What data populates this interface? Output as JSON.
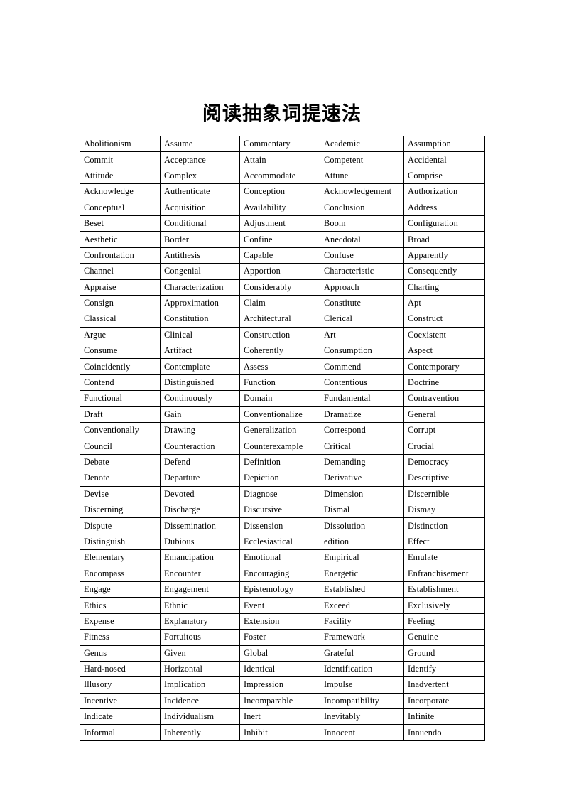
{
  "document": {
    "title": "阅读抽象词提速法"
  },
  "table": {
    "column_count": 5,
    "row_count": 38,
    "rows": [
      [
        "Abolitionism",
        "Assume",
        "Commentary",
        "Academic",
        "Assumption"
      ],
      [
        "Commit",
        "Acceptance",
        "Attain",
        "Competent",
        "Accidental"
      ],
      [
        "Attitude",
        "Complex",
        "Accommodate",
        "Attune",
        "Comprise"
      ],
      [
        "Acknowledge",
        "Authenticate",
        "Conception",
        "Acknowledgement",
        "Authorization"
      ],
      [
        "Conceptual",
        "Acquisition",
        "Availability",
        "Conclusion",
        "Address"
      ],
      [
        "Beset",
        "Conditional",
        "Adjustment",
        "Boom",
        "Configuration"
      ],
      [
        "Aesthetic",
        "Border",
        "Confine",
        "Anecdotal",
        "Broad"
      ],
      [
        "Confrontation",
        "Antithesis",
        "Capable",
        "Confuse",
        "Apparently"
      ],
      [
        "Channel",
        "Congenial",
        "Apportion",
        "Characteristic",
        "Consequently"
      ],
      [
        "Appraise",
        "Characterization",
        "Considerably",
        "Approach",
        "Charting"
      ],
      [
        "Consign",
        "Approximation",
        "Claim",
        "Constitute",
        "Apt"
      ],
      [
        "Classical",
        "Constitution",
        "Architectural",
        "Clerical",
        "Construct"
      ],
      [
        "Argue",
        "Clinical",
        "Construction",
        "Art",
        "Coexistent"
      ],
      [
        "Consume",
        "Artifact",
        "Coherently",
        "Consumption",
        "Aspect"
      ],
      [
        "Coincidently",
        "Contemplate",
        "Assess",
        "Commend",
        "Contemporary"
      ],
      [
        "Contend",
        "Distinguished",
        "Function",
        "Contentious",
        "Doctrine"
      ],
      [
        "Functional",
        "Continuously",
        "Domain",
        "Fundamental",
        "Contravention"
      ],
      [
        "Draft",
        "Gain",
        "Conventionalize",
        "Dramatize",
        "General"
      ],
      [
        "Conventionally",
        "Drawing",
        "Generalization",
        "Correspond",
        "Corrupt"
      ],
      [
        "Council",
        "Counteraction",
        "Counterexample",
        "Critical",
        "Crucial"
      ],
      [
        "Debate",
        "Defend",
        "Definition",
        "Demanding",
        "Democracy"
      ],
      [
        "Denote",
        "Departure",
        "Depiction",
        "Derivative",
        "Descriptive"
      ],
      [
        "Devise",
        "Devoted",
        "Diagnose",
        "Dimension",
        "Discernible"
      ],
      [
        "Discerning",
        "Discharge",
        "Discursive",
        "Dismal",
        "Dismay"
      ],
      [
        "Dispute",
        "Dissemination",
        "Dissension",
        "Dissolution",
        "Distinction"
      ],
      [
        "Distinguish",
        "Dubious",
        "Ecclesiastical",
        "edition",
        "Effect"
      ],
      [
        "Elementary",
        "Emancipation",
        "Emotional",
        "Empirical",
        "Emulate"
      ],
      [
        "Encompass",
        "Encounter",
        "Encouraging",
        "Energetic",
        "Enfranchisement"
      ],
      [
        "Engage",
        "Engagement",
        "Epistemology",
        "Established",
        "Establishment"
      ],
      [
        "Ethics",
        "Ethnic",
        "Event",
        "Exceed",
        "Exclusively"
      ],
      [
        "Expense",
        "Explanatory",
        "Extension",
        "Facility",
        "Feeling"
      ],
      [
        "Fitness",
        "Fortuitous",
        "Foster",
        "Framework",
        "Genuine"
      ],
      [
        "Genus",
        "Given",
        "Global",
        "Grateful",
        "Ground"
      ],
      [
        "Hard-nosed",
        "Horizontal",
        "Identical",
        "Identification",
        "Identify"
      ],
      [
        "Illusory",
        "Implication",
        "Impression",
        "Impulse",
        "Inadvertent"
      ],
      [
        "Incentive",
        "Incidence",
        "Incomparable",
        "Incompatibility",
        "Incorporate"
      ],
      [
        "Indicate",
        "Individualism",
        "Inert",
        "Inevitably",
        "Infinite"
      ],
      [
        "Informal",
        "Inherently",
        "Inhibit",
        "Innocent",
        "Innuendo"
      ]
    ]
  },
  "colors": {
    "page_background": "#ffffff",
    "text": "#000000",
    "table_border": "#000000"
  }
}
